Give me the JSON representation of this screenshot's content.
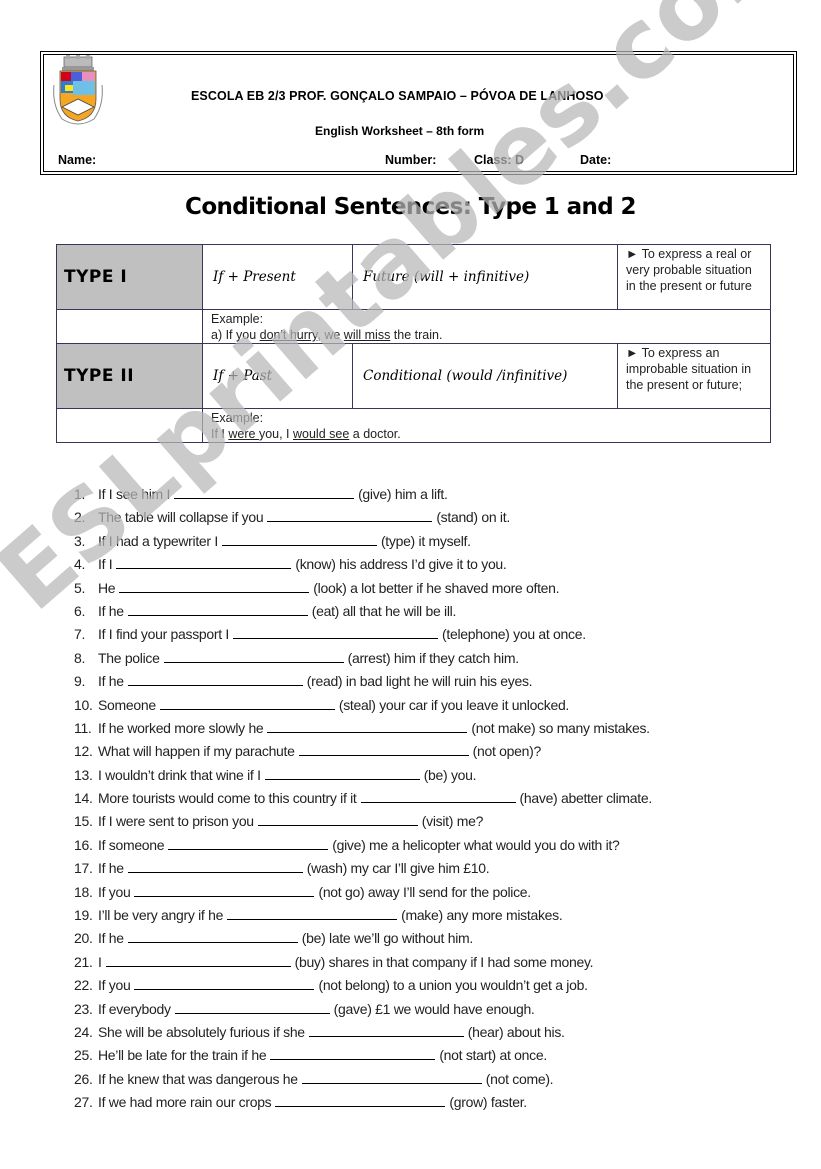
{
  "header": {
    "school_name": "ESCOLA EB 2/3 PROF. GONÇALO SAMPAIO – PÓVOA DE LANHOSO",
    "subtitle": "English Worksheet – 8th form",
    "fields": {
      "name_label": "Name:",
      "number_label": "Number:",
      "class_label": "Class: D",
      "date_label": "Date:"
    },
    "logo": "school-coat-of-arms-icon"
  },
  "title": "Conditional Sentences: Type 1 and 2",
  "table": {
    "type1": {
      "label": "TYPE  I",
      "if_clause": "If +  Present",
      "main_clause": "Future (will + infinitive)",
      "usage": "► To express a real or very probable situation in the present or future",
      "example_label": "Example:",
      "example": {
        "p1": "a) If you ",
        "u1": "don't hurry",
        "p2": ", we ",
        "u2": "will miss",
        "p3": " the train."
      }
    },
    "type2": {
      "label": "TYPE  II",
      "if_clause": "If + Past",
      "main_clause": "Conditional  (would /infinitive)",
      "usage": "► To express an improbable situation in the present or future;",
      "example_label": "Example:",
      "example": {
        "p1": "If I ",
        "u1": "were ",
        "p2": "you, I ",
        "u2": "would see",
        "p3": " a doctor."
      }
    }
  },
  "exercises": [
    {
      "num": "1.",
      "before": "If I see him I",
      "verb": "(give) him a lift."
    },
    {
      "num": "2.",
      "before": "The table will collapse if you",
      "verb": "(stand) on it."
    },
    {
      "num": "3.",
      "before": "If I had a typewriter I",
      "verb": "(type) it myself."
    },
    {
      "num": "4.",
      "before": "If I",
      "verb": "(know) his address I’d give it to you."
    },
    {
      "num": "5.",
      "before": "He",
      "verb": "(look) a lot better if he shaved more often."
    },
    {
      "num": "6.",
      "before": "If he",
      "verb": "(eat) all that he will be ill."
    },
    {
      "num": "7.",
      "before": "If I find your passport I",
      "verb": "(telephone) you at once."
    },
    {
      "num": "8.",
      "before": "The police",
      "verb": "(arrest) him if they catch him."
    },
    {
      "num": "9.",
      "before": "If he",
      "verb": "(read) in bad light he will ruin his eyes."
    },
    {
      "num": "10.",
      "before": "Someone",
      "verb": "(steal) your car if you leave it unlocked."
    },
    {
      "num": "11.",
      "before": "If he worked more slowly he",
      "verb": "(not make) so many mistakes."
    },
    {
      "num": "12.",
      "before": "What will happen if my parachute",
      "verb": "(not open)?"
    },
    {
      "num": "13.",
      "before": "I wouldn’t drink that wine if I",
      "verb": "(be) you."
    },
    {
      "num": "14.",
      "before": "More tourists would come to this country if it",
      "verb": "(have) abetter climate."
    },
    {
      "num": "15.",
      "before": "If I were sent to prison you",
      "verb": "(visit) me?"
    },
    {
      "num": "16.",
      "before": "If someone",
      "verb": "(give) me a helicopter what would you do with it?"
    },
    {
      "num": "17.",
      "before": "If he",
      "verb": "(wash) my car I’ll give him £10."
    },
    {
      "num": "18.",
      "before": "If you",
      "verb": "(not go) away I’ll send for the police."
    },
    {
      "num": "19.",
      "before": "I’ll be very angry if he",
      "verb": "(make) any more mistakes."
    },
    {
      "num": "20.",
      "before": "If he",
      "verb": "(be) late we’ll go without him."
    },
    {
      "num": "21.",
      "before": "I",
      "verb": "(buy) shares in that company if I had some money."
    },
    {
      "num": "22.",
      "before": "If you",
      "verb": "(not belong) to a union you wouldn’t get a job."
    },
    {
      "num": "23.",
      "before": "If everybody",
      "verb": "(gave) £1 we would have enough."
    },
    {
      "num": "24.",
      "before": "She will be absolutely furious if she",
      "verb": "(hear) about his."
    },
    {
      "num": "25.",
      "before": "He’ll be late for the train if he",
      "verb": "(not start) at once."
    },
    {
      "num": "26.",
      "before": "If he knew that was dangerous he",
      "verb": "(not come)."
    },
    {
      "num": "27.",
      "before": "If we had more rain our crops",
      "verb": "(grow) faster."
    }
  ],
  "watermark": "ESLprintables.com"
}
